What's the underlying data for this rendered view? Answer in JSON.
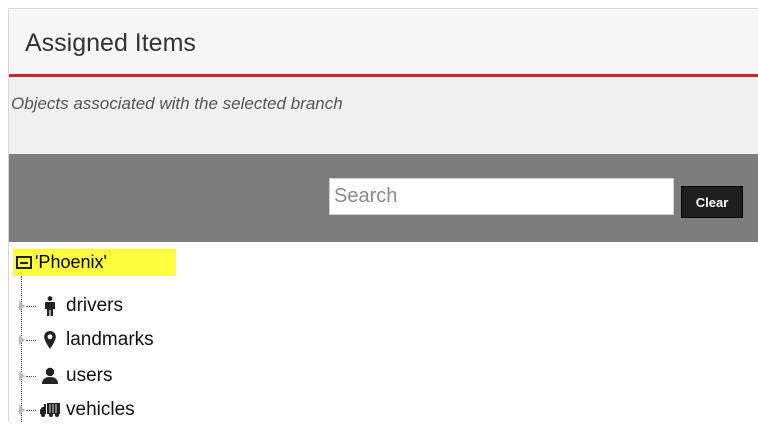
{
  "panel": {
    "title": "Assigned Items",
    "subtitle": "Objects associated with the selected branch"
  },
  "toolbar": {
    "search_placeholder": "Search",
    "search_value": "",
    "clear_label": "Clear"
  },
  "tree": {
    "root_label": "'Phoenix'",
    "items": [
      {
        "label": "drivers",
        "icon": "person-icon"
      },
      {
        "label": "landmarks",
        "icon": "map-marker-icon"
      },
      {
        "label": "users",
        "icon": "user-icon"
      },
      {
        "label": "vehicles",
        "icon": "truck-icon"
      }
    ]
  },
  "colors": {
    "accent_red": "#d4202a",
    "toolbar_gray": "#7d7d7d",
    "root_highlight": "#ffff3b",
    "button_dark": "#1e1e1e"
  }
}
